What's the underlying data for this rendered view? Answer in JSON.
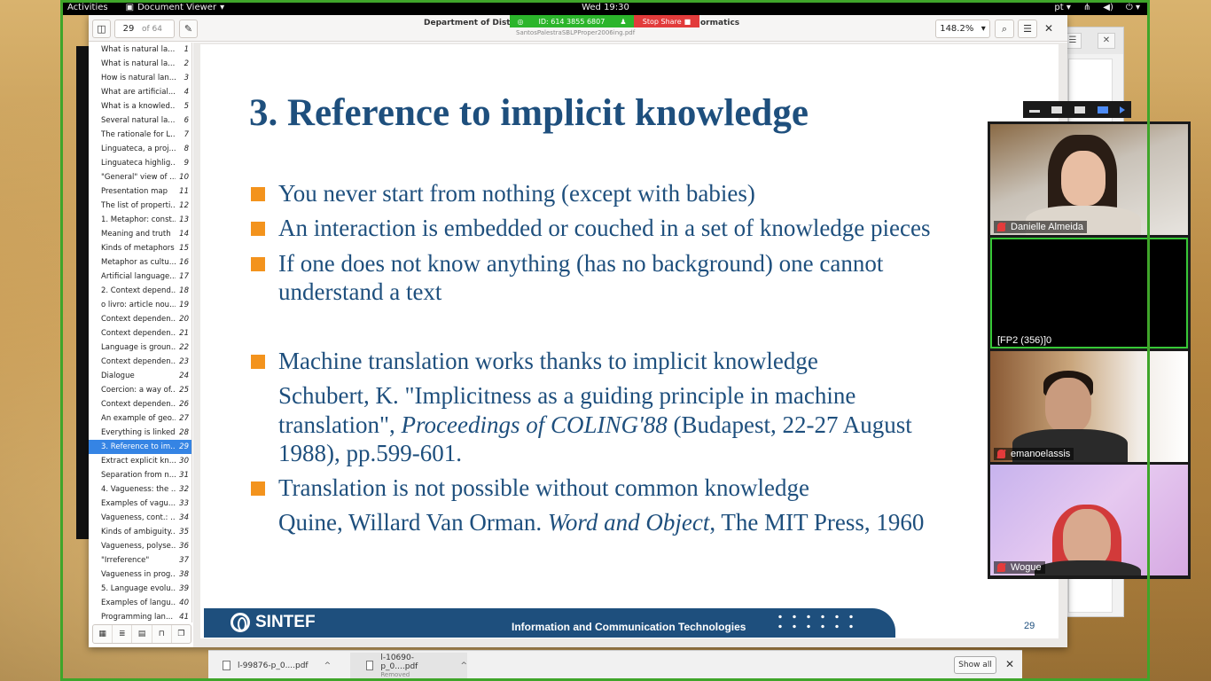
{
  "topbar": {
    "activities": "Activities",
    "app_name": "Document Viewer",
    "clock": "Wed 19:30",
    "lang": "pt"
  },
  "zoom_banner": {
    "meeting_id": "ID: 614 3855 6807",
    "stop_share": "Stop Share"
  },
  "viewer": {
    "page_current": "29",
    "page_total": "of 64",
    "title_left": "Department of Distribu",
    "title_right": "ormatics",
    "subtitle": "SantosPalestraSBLPProper2006ing.pdf",
    "zoom": "148.2%"
  },
  "toc": [
    {
      "label": "What is natural la...",
      "page": "1"
    },
    {
      "label": "What is natural la...",
      "page": "2"
    },
    {
      "label": "How is natural lan...",
      "page": "3"
    },
    {
      "label": "What are artificial...",
      "page": "4"
    },
    {
      "label": "What is a knowled...",
      "page": "5"
    },
    {
      "label": "Several natural la...",
      "page": "6"
    },
    {
      "label": "The rationale for L...",
      "page": "7"
    },
    {
      "label": "Linguateca, a proj...",
      "page": "8"
    },
    {
      "label": "Linguateca highlig...",
      "page": "9"
    },
    {
      "label": "\"General\" view of ...",
      "page": "10"
    },
    {
      "label": "Presentation map",
      "page": "11"
    },
    {
      "label": "The list of properti...",
      "page": "12"
    },
    {
      "label": "1. Metaphor: const...",
      "page": "13"
    },
    {
      "label": "Meaning and truth",
      "page": "14"
    },
    {
      "label": "Kinds of metaphors",
      "page": "15"
    },
    {
      "label": "Metaphor as cultu...",
      "page": "16"
    },
    {
      "label": "Artificial language...",
      "page": "17"
    },
    {
      "label": "2. Context depend...",
      "page": "18"
    },
    {
      "label": "o livro: article nou...",
      "page": "19"
    },
    {
      "label": "Context dependen...",
      "page": "20"
    },
    {
      "label": "Context dependen...",
      "page": "21"
    },
    {
      "label": "Language is groun...",
      "page": "22"
    },
    {
      "label": "Context dependen...",
      "page": "23"
    },
    {
      "label": "Dialogue",
      "page": "24"
    },
    {
      "label": "Coercion: a way of...",
      "page": "25"
    },
    {
      "label": "Context dependen...",
      "page": "26"
    },
    {
      "label": "An example of geo...",
      "page": "27"
    },
    {
      "label": "Everything is linked",
      "page": "28"
    },
    {
      "label": "3. Reference to im...",
      "page": "29"
    },
    {
      "label": "Extract explicit kn...",
      "page": "30"
    },
    {
      "label": "Separation from n...",
      "page": "31"
    },
    {
      "label": "4. Vagueness: the ...",
      "page": "32"
    },
    {
      "label": "Examples of vagu...",
      "page": "33"
    },
    {
      "label": "Vagueness, cont.: ...",
      "page": "34"
    },
    {
      "label": "Kinds of ambiguity...",
      "page": "35"
    },
    {
      "label": "Vagueness, polyse...",
      "page": "36"
    },
    {
      "label": "\"Irreference\"",
      "page": "37"
    },
    {
      "label": "Vagueness in prog...",
      "page": "38"
    },
    {
      "label": "5. Language evolu...",
      "page": "39"
    },
    {
      "label": "Examples of langu...",
      "page": "40"
    },
    {
      "label": "Programming lan...",
      "page": "41"
    }
  ],
  "slide": {
    "title": "3. Reference to implicit knowledge",
    "b1": "You never start from nothing (except with babies)",
    "b2": "An interaction is embedded or couched in a set of knowledge pieces",
    "b3_l1": "If one does not know anything (has no background) one cannot",
    "b3_l2": "understand a text",
    "b4": "Machine translation works thanks to implicit knowledge",
    "ref1_l1": "Schubert, K. \"Implicitness as a guiding principle in machine",
    "ref1_l2a": "translation\", ",
    "ref1_l2b": "Proceedings of COLING'88",
    "ref1_l2c": " (Budapest, 22-27 August",
    "ref1_l3": "1988), pp.599-601.",
    "b5": "Translation is not possible without common knowledge",
    "ref2_a": "Quine, Willard Van Orman. ",
    "ref2_b": "Word and Object",
    "ref2_c": ", The MIT Press, 1960",
    "footer_brand": "SINTEF",
    "footer_text": "Information and Communication Technologies",
    "page_number": "29"
  },
  "downloads": {
    "item1": "l-99876-p_0....pdf",
    "item2": "l-10690-p_0....pdf",
    "item2_status": "Removed",
    "show_all": "Show all"
  },
  "participants": [
    {
      "name": "Danielle Almeida"
    },
    {
      "name": "[FP2 (356)]0"
    },
    {
      "name": "emanoelassis"
    },
    {
      "name": "Wogue"
    }
  ],
  "colors": {
    "accent": "#3584e4",
    "slide_blue": "#1e4f7d",
    "bullet_orange": "#f3931d",
    "share_green": "#3fa52a",
    "stop_red": "#e23b3b"
  }
}
